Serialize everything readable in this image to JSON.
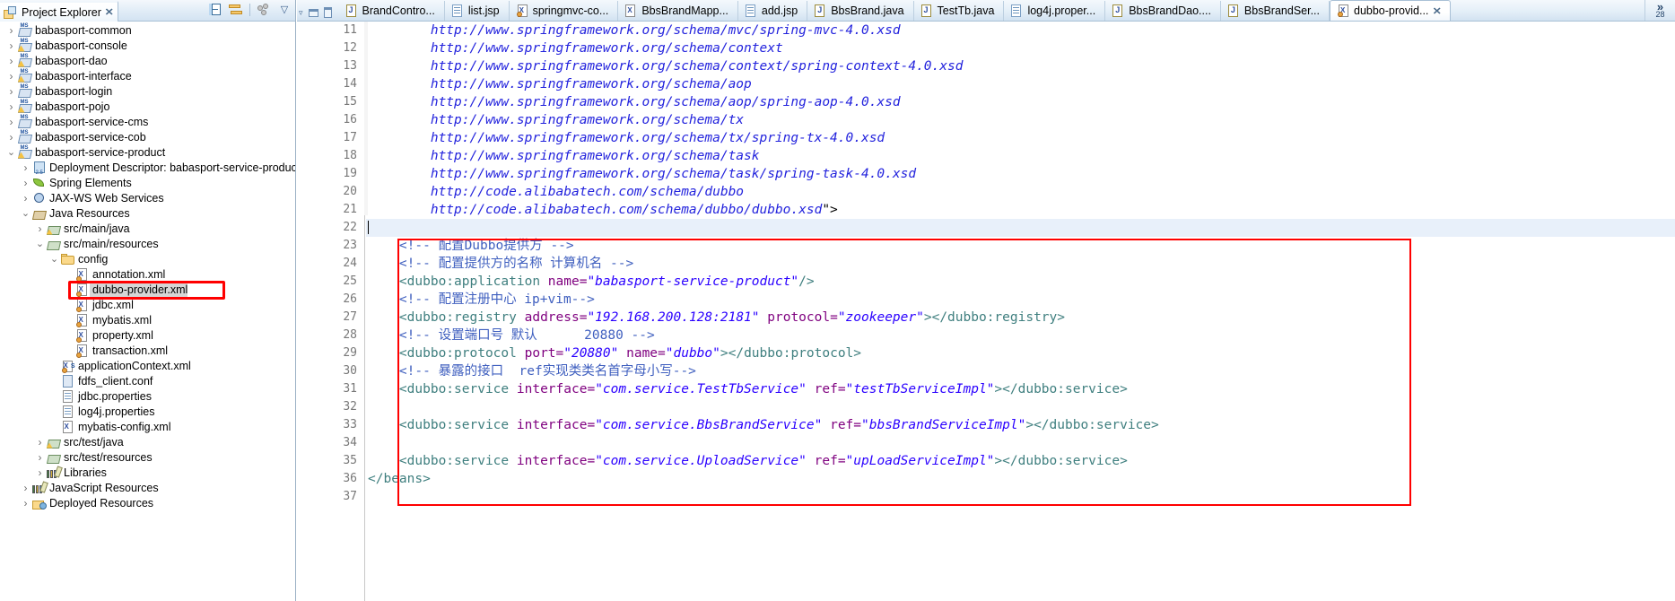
{
  "explorer": {
    "title": "Project Explorer",
    "close_label": "✕",
    "toolbar": [
      {
        "name": "collapse-all-icon",
        "label": "⊟"
      },
      {
        "name": "link-with-editor-icon",
        "label": "⇄"
      },
      {
        "name": "view-menu-icon",
        "label": "⋯"
      },
      {
        "name": "view-dropdown-icon",
        "label": "▽"
      }
    ],
    "tree": [
      {
        "depth": 0,
        "arrow": "›",
        "icon": "maven-project-icon",
        "label": "babasport-common",
        "warn": false,
        "selected": false
      },
      {
        "depth": 0,
        "arrow": "›",
        "icon": "maven-project-icon",
        "label": "babasport-console",
        "warn": true,
        "selected": false
      },
      {
        "depth": 0,
        "arrow": "›",
        "icon": "maven-project-icon",
        "label": "babasport-dao",
        "warn": true,
        "selected": false
      },
      {
        "depth": 0,
        "arrow": "›",
        "icon": "maven-project-icon",
        "label": "babasport-interface",
        "warn": true,
        "selected": false
      },
      {
        "depth": 0,
        "arrow": "›",
        "icon": "maven-project-icon",
        "label": "babasport-login",
        "warn": false,
        "selected": false
      },
      {
        "depth": 0,
        "arrow": "›",
        "icon": "maven-project-icon",
        "label": "babasport-pojo",
        "warn": true,
        "selected": false
      },
      {
        "depth": 0,
        "arrow": "›",
        "icon": "maven-project-icon",
        "label": "babasport-service-cms",
        "warn": false,
        "selected": false
      },
      {
        "depth": 0,
        "arrow": "›",
        "icon": "maven-project-icon",
        "label": "babasport-service-cob",
        "warn": false,
        "selected": false
      },
      {
        "depth": 0,
        "arrow": "⌄",
        "icon": "maven-project-icon",
        "label": "babasport-service-product",
        "warn": true,
        "selected": false
      },
      {
        "depth": 1,
        "arrow": "›",
        "icon": "deployment-descriptor-icon",
        "label": "Deployment Descriptor: babasport-service-product",
        "warn": false,
        "selected": false
      },
      {
        "depth": 1,
        "arrow": "›",
        "icon": "spring-leaf-icon",
        "label": "Spring Elements",
        "warn": false,
        "selected": false
      },
      {
        "depth": 1,
        "arrow": "›",
        "icon": "jaxws-icon",
        "label": "JAX-WS Web Services",
        "warn": false,
        "selected": false
      },
      {
        "depth": 1,
        "arrow": "⌄",
        "icon": "java-resources-icon",
        "label": "Java Resources",
        "warn": false,
        "selected": false
      },
      {
        "depth": 2,
        "arrow": "›",
        "icon": "source-folder-icon",
        "label": "src/main/java",
        "warn": true,
        "selected": false
      },
      {
        "depth": 2,
        "arrow": "⌄",
        "icon": "source-folder-icon",
        "label": "src/main/resources",
        "warn": false,
        "selected": false
      },
      {
        "depth": 3,
        "arrow": "⌄",
        "icon": "folder-icon",
        "label": "config",
        "warn": false,
        "selected": false
      },
      {
        "depth": 4,
        "arrow": "",
        "icon": "xml-bean-file-icon",
        "label": "annotation.xml",
        "warn": false,
        "selected": false
      },
      {
        "depth": 4,
        "arrow": "",
        "icon": "xml-bean-file-icon",
        "label": "dubbo-provider.xml",
        "warn": false,
        "selected": true
      },
      {
        "depth": 4,
        "arrow": "",
        "icon": "xml-bean-file-icon",
        "label": "jdbc.xml",
        "warn": false,
        "selected": false
      },
      {
        "depth": 4,
        "arrow": "",
        "icon": "xml-bean-file-icon",
        "label": "mybatis.xml",
        "warn": false,
        "selected": false
      },
      {
        "depth": 4,
        "arrow": "",
        "icon": "xml-bean-file-icon",
        "label": "property.xml",
        "warn": false,
        "selected": false
      },
      {
        "depth": 4,
        "arrow": "",
        "icon": "xml-bean-file-icon",
        "label": "transaction.xml",
        "warn": false,
        "selected": false
      },
      {
        "depth": 3,
        "arrow": "",
        "icon": "application-context-icon",
        "label": "applicationContext.xml",
        "warn": false,
        "selected": false
      },
      {
        "depth": 3,
        "arrow": "",
        "icon": "conf-file-icon",
        "label": "fdfs_client.conf",
        "warn": false,
        "selected": false
      },
      {
        "depth": 3,
        "arrow": "",
        "icon": "properties-file-icon",
        "label": "jdbc.properties",
        "warn": false,
        "selected": false
      },
      {
        "depth": 3,
        "arrow": "",
        "icon": "properties-file-icon",
        "label": "log4j.properties",
        "warn": false,
        "selected": false
      },
      {
        "depth": 3,
        "arrow": "",
        "icon": "plain-xml-file-icon",
        "label": "mybatis-config.xml",
        "warn": false,
        "selected": false
      },
      {
        "depth": 2,
        "arrow": "›",
        "icon": "source-folder-icon",
        "label": "src/test/java",
        "warn": true,
        "selected": false
      },
      {
        "depth": 2,
        "arrow": "›",
        "icon": "source-folder-icon",
        "label": "src/test/resources",
        "warn": false,
        "selected": false
      },
      {
        "depth": 2,
        "arrow": "›",
        "icon": "libraries-icon",
        "label": "Libraries",
        "warn": false,
        "selected": false
      },
      {
        "depth": 1,
        "arrow": "›",
        "icon": "libraries-icon",
        "label": "JavaScript Resources",
        "warn": false,
        "selected": false
      },
      {
        "depth": 1,
        "arrow": "›",
        "icon": "deployed-resources-icon",
        "label": "Deployed Resources",
        "warn": false,
        "selected": false
      }
    ]
  },
  "editor": {
    "tabs": [
      {
        "label": "BrandContro...",
        "icon": "java-file-icon",
        "active": false
      },
      {
        "label": "list.jsp",
        "icon": "jsp-file-icon",
        "active": false
      },
      {
        "label": "springmvc-co...",
        "icon": "xml-bean-file-icon",
        "active": false
      },
      {
        "label": "BbsBrandMapp...",
        "icon": "plain-xml-file-icon",
        "active": false
      },
      {
        "label": "add.jsp",
        "icon": "jsp-file-icon",
        "active": false
      },
      {
        "label": "BbsBrand.java",
        "icon": "java-file-icon",
        "active": false
      },
      {
        "label": "TestTb.java",
        "icon": "java-file-icon",
        "active": false
      },
      {
        "label": "log4j.proper...",
        "icon": "properties-file-icon",
        "active": false
      },
      {
        "label": "BbsBrandDao....",
        "icon": "java-file-icon",
        "active": false
      },
      {
        "label": "BbsBrandSer...",
        "icon": "java-file-icon",
        "active": false
      },
      {
        "label": "dubbo-provid...",
        "icon": "xml-bean-file-icon",
        "active": true,
        "close_label": "✕"
      }
    ],
    "overflow": {
      "chevron": "»",
      "count": "28"
    },
    "line_numbers": [
      "11",
      "12",
      "13",
      "14",
      "15",
      "16",
      "17",
      "18",
      "19",
      "20",
      "21",
      "22",
      "23",
      "24",
      "25",
      "26",
      "27",
      "28",
      "29",
      "30",
      "31",
      "32",
      "33",
      "34",
      "35",
      "36",
      "37"
    ],
    "lines": [
      {
        "n": "11",
        "segments": [
          {
            "t": "        http://www.springframework.org/schema/mvc/spring-mvc-4.0.xsd",
            "c": "url"
          }
        ]
      },
      {
        "n": "12",
        "segments": [
          {
            "t": "        http://www.springframework.org/schema/context",
            "c": "url"
          }
        ]
      },
      {
        "n": "13",
        "segments": [
          {
            "t": "        http://www.springframework.org/schema/context/spring-context-4.0.xsd",
            "c": "url"
          }
        ]
      },
      {
        "n": "14",
        "segments": [
          {
            "t": "        http://www.springframework.org/schema/aop",
            "c": "url"
          }
        ]
      },
      {
        "n": "15",
        "segments": [
          {
            "t": "        http://www.springframework.org/schema/aop/spring-aop-4.0.xsd",
            "c": "url"
          }
        ]
      },
      {
        "n": "16",
        "segments": [
          {
            "t": "        http://www.springframework.org/schema/tx",
            "c": "url"
          }
        ]
      },
      {
        "n": "17",
        "segments": [
          {
            "t": "        http://www.springframework.org/schema/tx/spring-tx-4.0.xsd",
            "c": "url"
          }
        ]
      },
      {
        "n": "18",
        "segments": [
          {
            "t": "        http://www.springframework.org/schema/task",
            "c": "url"
          }
        ]
      },
      {
        "n": "19",
        "segments": [
          {
            "t": "        http://www.springframework.org/schema/task/spring-task-4.0.xsd",
            "c": "url"
          }
        ]
      },
      {
        "n": "20",
        "segments": [
          {
            "t": "        http://code.alibabatech.com/schema/dubbo",
            "c": "url"
          }
        ]
      },
      {
        "n": "21",
        "segments": [
          {
            "t": "        http://code.alibabatech.com/schema/dubbo/dubbo.xsd",
            "c": "url"
          },
          {
            "t": "\">",
            "c": "punct"
          }
        ]
      },
      {
        "n": "22",
        "segments": []
      },
      {
        "n": "23",
        "segments": [
          {
            "t": "    ",
            "c": "punct"
          },
          {
            "t": "<!-- 配置Dubbo提供方 -->",
            "c": "cmt"
          }
        ]
      },
      {
        "n": "24",
        "segments": [
          {
            "t": "    ",
            "c": "punct"
          },
          {
            "t": "<!-- 配置提供方的名称 计算机名 -->",
            "c": "cmt"
          }
        ]
      },
      {
        "n": "25",
        "segments": [
          {
            "t": "    ",
            "c": "punct"
          },
          {
            "t": "<dubbo:application ",
            "c": "tag"
          },
          {
            "t": "name=",
            "c": "attr"
          },
          {
            "t": "\"babasport-service-product\"",
            "c": "val"
          },
          {
            "t": "/>",
            "c": "tag"
          }
        ]
      },
      {
        "n": "26",
        "segments": [
          {
            "t": "    ",
            "c": "punct"
          },
          {
            "t": "<!-- 配置注册中心 ip+vim-->",
            "c": "cmt"
          }
        ]
      },
      {
        "n": "27",
        "segments": [
          {
            "t": "    ",
            "c": "punct"
          },
          {
            "t": "<dubbo:registry ",
            "c": "tag"
          },
          {
            "t": "address=",
            "c": "attr"
          },
          {
            "t": "\"192.168.200.128:2181\"",
            "c": "val"
          },
          {
            "t": " ",
            "c": "punct"
          },
          {
            "t": "protocol=",
            "c": "attr"
          },
          {
            "t": "\"zookeeper\"",
            "c": "val"
          },
          {
            "t": "></dubbo:registry>",
            "c": "tag"
          }
        ]
      },
      {
        "n": "28",
        "segments": [
          {
            "t": "    ",
            "c": "punct"
          },
          {
            "t": "<!-- 设置端口号 默认      20880 -->",
            "c": "cmt"
          }
        ]
      },
      {
        "n": "29",
        "segments": [
          {
            "t": "    ",
            "c": "punct"
          },
          {
            "t": "<dubbo:protocol ",
            "c": "tag"
          },
          {
            "t": "port=",
            "c": "attr"
          },
          {
            "t": "\"20880\"",
            "c": "val"
          },
          {
            "t": " ",
            "c": "punct"
          },
          {
            "t": "name=",
            "c": "attr"
          },
          {
            "t": "\"dubbo\"",
            "c": "val"
          },
          {
            "t": "></dubbo:protocol>",
            "c": "tag"
          }
        ]
      },
      {
        "n": "30",
        "segments": [
          {
            "t": "    ",
            "c": "punct"
          },
          {
            "t": "<!-- 暴露的接口  ref实现类类名首字母小写-->",
            "c": "cmt"
          }
        ]
      },
      {
        "n": "31",
        "segments": [
          {
            "t": "    ",
            "c": "punct"
          },
          {
            "t": "<dubbo:service ",
            "c": "tag"
          },
          {
            "t": "interface=",
            "c": "attr"
          },
          {
            "t": "\"com.service.TestTbService\"",
            "c": "val"
          },
          {
            "t": " ",
            "c": "punct"
          },
          {
            "t": "ref=",
            "c": "attr"
          },
          {
            "t": "\"testTbServiceImpl\"",
            "c": "val"
          },
          {
            "t": "></dubbo:service>",
            "c": "tag"
          }
        ]
      },
      {
        "n": "32",
        "segments": []
      },
      {
        "n": "33",
        "segments": [
          {
            "t": "    ",
            "c": "punct"
          },
          {
            "t": "<dubbo:service ",
            "c": "tag"
          },
          {
            "t": "interface=",
            "c": "attr"
          },
          {
            "t": "\"com.service.BbsBrandService\"",
            "c": "val"
          },
          {
            "t": " ",
            "c": "punct"
          },
          {
            "t": "ref=",
            "c": "attr"
          },
          {
            "t": "\"bbsBrandServiceImpl\"",
            "c": "val"
          },
          {
            "t": "></dubbo:service>",
            "c": "tag"
          }
        ]
      },
      {
        "n": "34",
        "segments": []
      },
      {
        "n": "35",
        "segments": [
          {
            "t": "    ",
            "c": "punct"
          },
          {
            "t": "<dubbo:service ",
            "c": "tag"
          },
          {
            "t": "interface=",
            "c": "attr"
          },
          {
            "t": "\"com.service.UploadService\"",
            "c": "val"
          },
          {
            "t": " ",
            "c": "punct"
          },
          {
            "t": "ref=",
            "c": "attr"
          },
          {
            "t": "\"upLoadServiceImpl\"",
            "c": "val"
          },
          {
            "t": "></dubbo:service>",
            "c": "tag"
          }
        ]
      },
      {
        "n": "36",
        "segments": [
          {
            "t": "</beans>",
            "c": "tag"
          }
        ]
      },
      {
        "n": "37",
        "segments": []
      }
    ],
    "current_line_index": 11
  },
  "colors": {
    "highlight_red": "#ff0000",
    "url_blue": "#2323dd",
    "tag_teal": "#3f7f7f",
    "attr_purple": "#7f007f",
    "value_blue": "#2a00ff",
    "comment_blue": "#3f5fbf",
    "current_line": "#e8f0fa"
  }
}
